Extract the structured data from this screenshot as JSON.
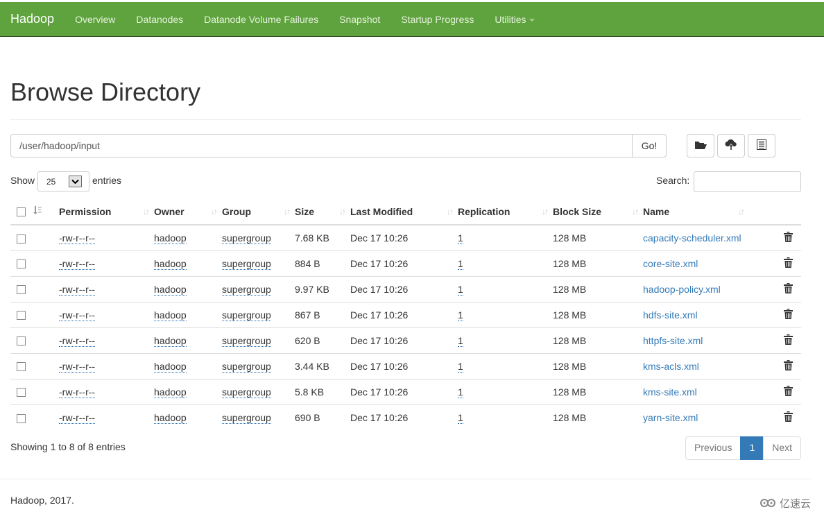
{
  "navbar": {
    "brand": "Hadoop",
    "items": [
      "Overview",
      "Datanodes",
      "Datanode Volume Failures",
      "Snapshot",
      "Startup Progress",
      "Utilities"
    ]
  },
  "page": {
    "title": "Browse Directory",
    "path_value": "/user/hadoop/input",
    "go_label": "Go!",
    "toolbar": [
      "folder-open-icon",
      "cloud-upload-icon",
      "list-alt-icon"
    ]
  },
  "table_controls": {
    "show_label": "Show",
    "page_length": "25",
    "entries_label": "entries",
    "search_label": "Search:",
    "search_value": ""
  },
  "table": {
    "columns": [
      "Permission",
      "Owner",
      "Group",
      "Size",
      "Last Modified",
      "Replication",
      "Block Size",
      "Name"
    ],
    "rows": [
      {
        "permission": "-rw-r--r--",
        "owner": "hadoop",
        "group": "supergroup",
        "size": "7.68 KB",
        "modified": "Dec 17 10:26",
        "replication": "1",
        "block_size": "128 MB",
        "name": "capacity-scheduler.xml"
      },
      {
        "permission": "-rw-r--r--",
        "owner": "hadoop",
        "group": "supergroup",
        "size": "884 B",
        "modified": "Dec 17 10:26",
        "replication": "1",
        "block_size": "128 MB",
        "name": "core-site.xml"
      },
      {
        "permission": "-rw-r--r--",
        "owner": "hadoop",
        "group": "supergroup",
        "size": "9.97 KB",
        "modified": "Dec 17 10:26",
        "replication": "1",
        "block_size": "128 MB",
        "name": "hadoop-policy.xml"
      },
      {
        "permission": "-rw-r--r--",
        "owner": "hadoop",
        "group": "supergroup",
        "size": "867 B",
        "modified": "Dec 17 10:26",
        "replication": "1",
        "block_size": "128 MB",
        "name": "hdfs-site.xml"
      },
      {
        "permission": "-rw-r--r--",
        "owner": "hadoop",
        "group": "supergroup",
        "size": "620 B",
        "modified": "Dec 17 10:26",
        "replication": "1",
        "block_size": "128 MB",
        "name": "httpfs-site.xml"
      },
      {
        "permission": "-rw-r--r--",
        "owner": "hadoop",
        "group": "supergroup",
        "size": "3.44 KB",
        "modified": "Dec 17 10:26",
        "replication": "1",
        "block_size": "128 MB",
        "name": "kms-acls.xml"
      },
      {
        "permission": "-rw-r--r--",
        "owner": "hadoop",
        "group": "supergroup",
        "size": "5.8 KB",
        "modified": "Dec 17 10:26",
        "replication": "1",
        "block_size": "128 MB",
        "name": "kms-site.xml"
      },
      {
        "permission": "-rw-r--r--",
        "owner": "hadoop",
        "group": "supergroup",
        "size": "690 B",
        "modified": "Dec 17 10:26",
        "replication": "1",
        "block_size": "128 MB",
        "name": "yarn-site.xml"
      }
    ]
  },
  "pagination": {
    "info": "Showing 1 to 8 of 8 entries",
    "previous": "Previous",
    "current": "1",
    "next": "Next"
  },
  "footer": {
    "text": "Hadoop, 2017.",
    "watermark": "亿速云"
  },
  "colors": {
    "navbar": "#5fa33e",
    "link": "#337ab7",
    "active_page": "#337ab7"
  }
}
